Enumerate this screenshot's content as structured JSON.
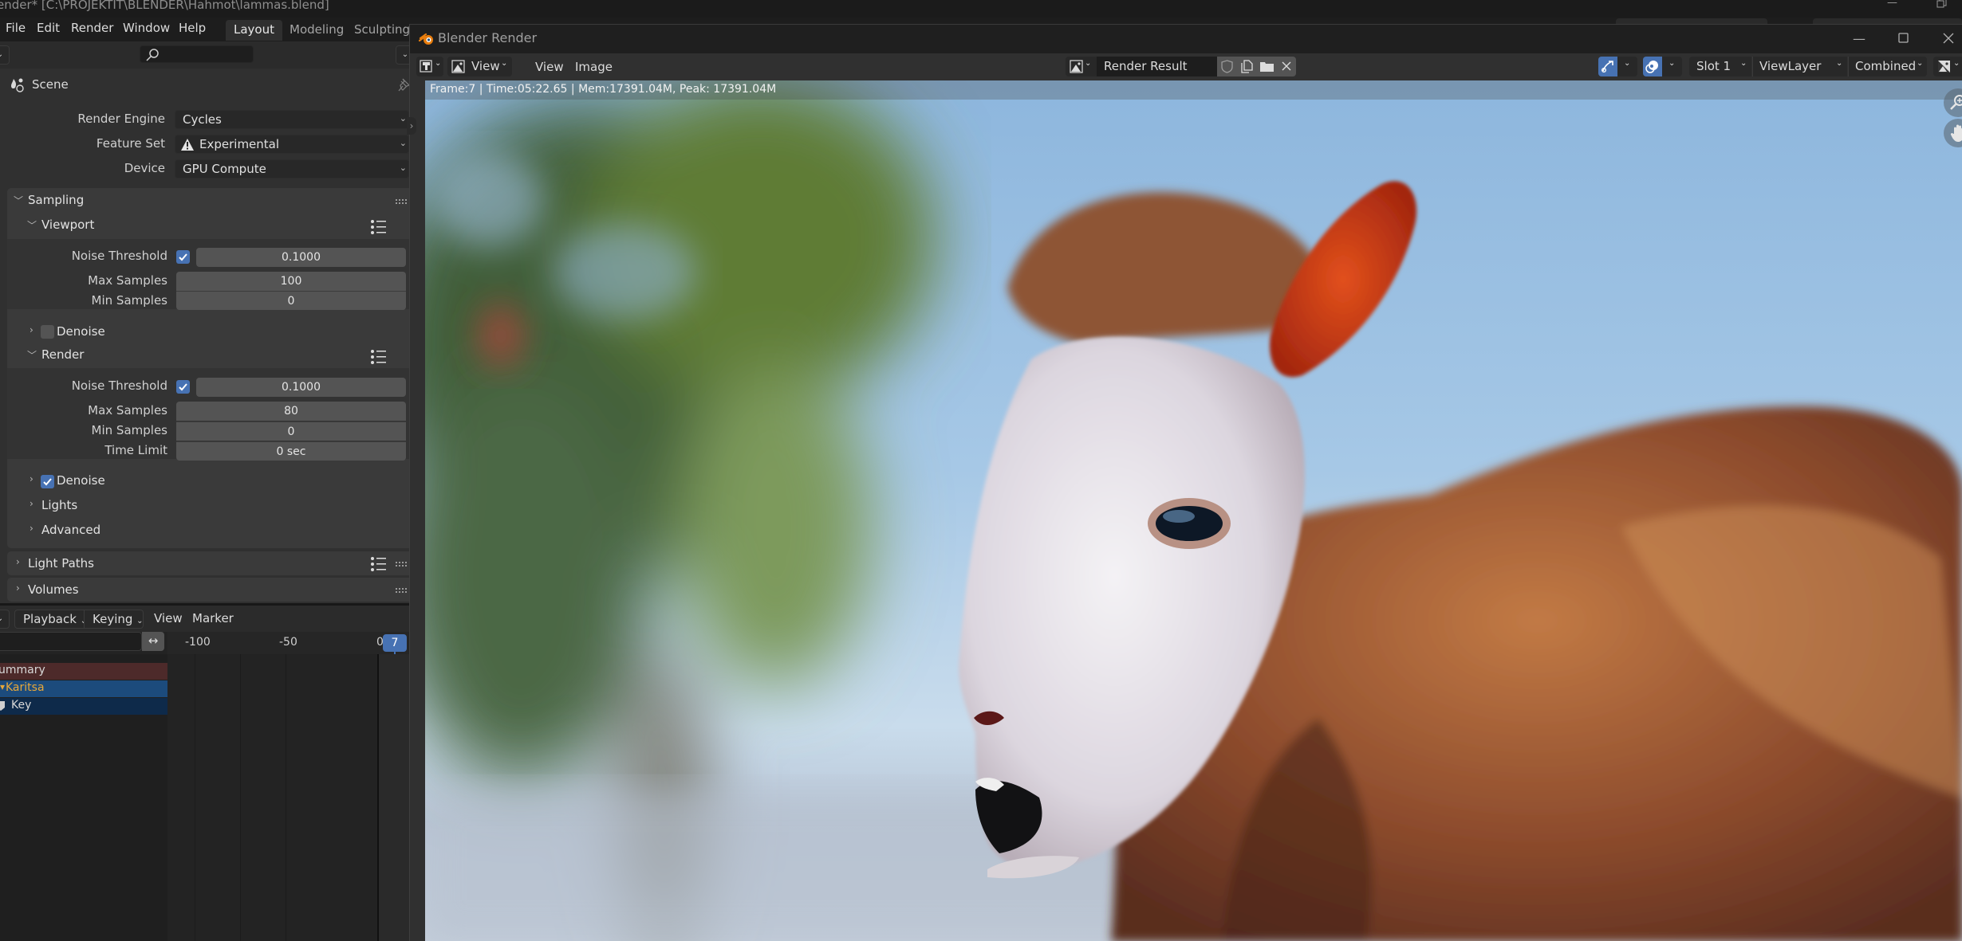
{
  "os_window": {
    "title": "ender* [C:\\PROJEKTIT\\BLENDER\\Hahmot\\lammas.blend]"
  },
  "menubar": {
    "items": [
      "File",
      "Edit",
      "Render",
      "Window",
      "Help"
    ],
    "workspace_tabs": [
      {
        "label": "Layout",
        "active": true
      },
      {
        "label": "Modeling",
        "active": false
      },
      {
        "label": "Sculpting",
        "active": false
      }
    ]
  },
  "properties": {
    "search_placeholder": "",
    "context": "Scene",
    "render_engine": {
      "label": "Render Engine",
      "value": "Cycles"
    },
    "feature_set": {
      "label": "Feature Set",
      "value": "Experimental",
      "icon": "warning-icon"
    },
    "device": {
      "label": "Device",
      "value": "GPU Compute"
    },
    "sampling": {
      "title": "Sampling",
      "viewport": {
        "title": "Viewport",
        "noise_threshold": {
          "label": "Noise Threshold",
          "enabled": true,
          "value": "0.1000"
        },
        "max_samples": {
          "label": "Max Samples",
          "value": "100"
        },
        "min_samples": {
          "label": "Min Samples",
          "value": "0"
        },
        "denoise": {
          "label": "Denoise",
          "enabled": false
        }
      },
      "render": {
        "title": "Render",
        "noise_threshold": {
          "label": "Noise Threshold",
          "enabled": true,
          "value": "0.1000"
        },
        "max_samples": {
          "label": "Max Samples",
          "value": "80"
        },
        "min_samples": {
          "label": "Min Samples",
          "value": "0"
        },
        "time_limit": {
          "label": "Time Limit",
          "value": "0 sec"
        },
        "denoise": {
          "label": "Denoise",
          "enabled": true
        }
      },
      "lights": {
        "title": "Lights"
      },
      "advanced": {
        "title": "Advanced"
      }
    },
    "light_paths": {
      "title": "Light Paths"
    },
    "volumes": {
      "title": "Volumes"
    }
  },
  "timeline": {
    "menus": {
      "playback": "Playback",
      "keying": "Keying",
      "view": "View",
      "marker": "Marker"
    },
    "ruler": [
      "-100",
      "-50",
      "0"
    ],
    "current_frame": "7",
    "channels": [
      {
        "label": "ummary",
        "color": "#4d2a2a",
        "text_color": "#d8d8d8"
      },
      {
        "label": "Karitsa",
        "color": "#1c4b7c",
        "text_color": "#e8a83a"
      },
      {
        "label": "Key",
        "color": "#0e2a4a",
        "text_color": "#d8d8d8"
      }
    ]
  },
  "render_window": {
    "title": "Blender Render",
    "header": {
      "view_dropdown": "View",
      "menus": [
        "View",
        "Image"
      ],
      "image_name": "Render Result",
      "slot": "Slot 1",
      "view_layer": "ViewLayer",
      "pass": "Combined"
    },
    "info": "Frame:7 | Time:05:22.65 | Mem:17391.04M, Peak: 17391.04M",
    "accent_color": "#4772b3"
  }
}
